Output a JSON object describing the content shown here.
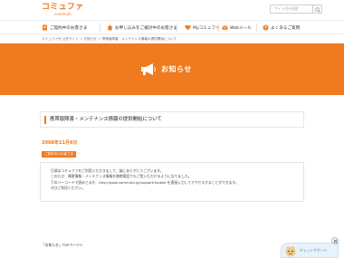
{
  "header": {
    "logo_main": "コミュファ",
    "logo_sub": "commufa",
    "search_placeholder": "サイト内を検索"
  },
  "nav": {
    "items": [
      {
        "label": "ご契約中のお客さま"
      },
      {
        "label": "お申し込みをご検討中のお客さま"
      },
      {
        "label": "Myコミュファ"
      },
      {
        "label": "Webメール"
      },
      {
        "label": "よくあるご質問"
      }
    ]
  },
  "breadcrumb": "コミュファ光 公式サイト ＞ お知らせ ＞ 携帯版障害・メンテナンス情報の提供開始について",
  "hero": {
    "title": "お知らせ"
  },
  "article": {
    "title": "携帯版障害・メンテナンス情報の提供開始について",
    "date": "2008年11月9日",
    "tag": "ご契約中のお客さま",
    "body": [
      "日頃はコミュファをご利用いただきまして、誠にありがとうございます。",
      "このたび、障害情報・メンテナンス情報を携帯電話でもご覧いただけるようになりました。",
      "下のバーコードで読みとるか、http://www.commufa.jp/support/mobile を直接入力してアクセスすることができます。",
      "ぜひご利用ください。"
    ]
  },
  "footer": {
    "links": "「お知らせ」TOPページへ"
  },
  "chat": {
    "label": "チャットサポート"
  },
  "colors": {
    "accent": "#f07a1f",
    "chat_bg": "#e8f2fb"
  }
}
